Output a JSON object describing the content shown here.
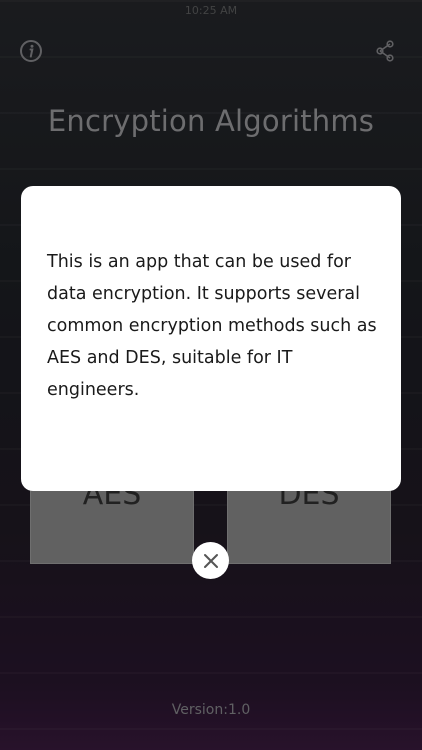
{
  "status_bar": {
    "time": "10:25 AM"
  },
  "header": {
    "title": "Encryption Algorithms",
    "info_icon": "info-icon",
    "share_icon": "share-icon"
  },
  "algorithms": [
    {
      "label": "AES"
    },
    {
      "label": "DES"
    }
  ],
  "dialog": {
    "message": "This is an app that can be used for data encryption. It supports several common encryption methods such as AES and DES, suitable for IT engineers.",
    "close_icon": "close-icon"
  },
  "footer": {
    "version": "Version:1.0"
  },
  "colors": {
    "tile": "#8c8c8c",
    "title_text": "#9c9ca0",
    "dialog_bg": "#ffffff"
  }
}
